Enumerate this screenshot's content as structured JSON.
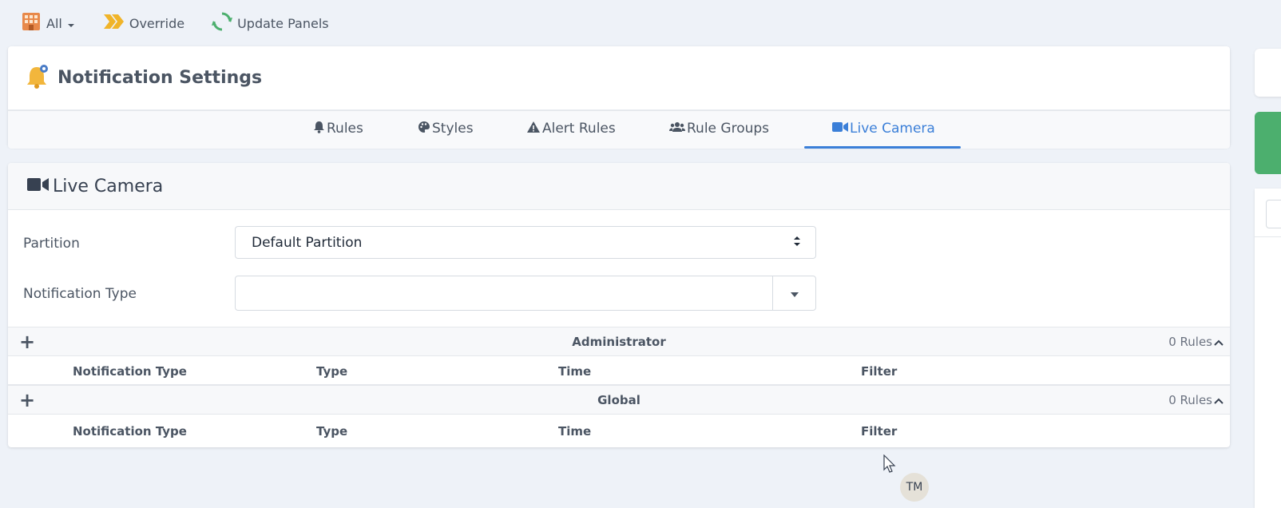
{
  "toolbar": {
    "all_label": "All",
    "override_label": "Override",
    "update_panels_label": "Update Panels"
  },
  "page": {
    "title": "Notification Settings"
  },
  "tabs": [
    {
      "label": "Rules",
      "icon": "bell-icon"
    },
    {
      "label": "Styles",
      "icon": "palette-icon"
    },
    {
      "label": "Alert Rules",
      "icon": "warning-icon"
    },
    {
      "label": "Rule Groups",
      "icon": "users-icon"
    },
    {
      "label": "Live Camera",
      "icon": "video-camera-icon",
      "active": true
    }
  ],
  "section": {
    "title": "Live Camera"
  },
  "form": {
    "partition_label": "Partition",
    "partition_value": "Default Partition",
    "notification_type_label": "Notification Type",
    "notification_type_value": ""
  },
  "groups": [
    {
      "name": "Administrator",
      "count": "0 Rules",
      "columns": [
        "Notification Type",
        "Type",
        "Time",
        "Filter"
      ]
    },
    {
      "name": "Global",
      "count": "0 Rules",
      "columns": [
        "Notification Type",
        "Type",
        "Time",
        "Filter"
      ]
    }
  ],
  "user": {
    "initials": "TM"
  },
  "colors": {
    "accent": "#3b7fd8",
    "green_panel": "#4caf6e",
    "background": "#eef2f8",
    "bell": "#f2b63c",
    "override_arrows": "#f0b429",
    "refresh": "#4caf6e"
  }
}
